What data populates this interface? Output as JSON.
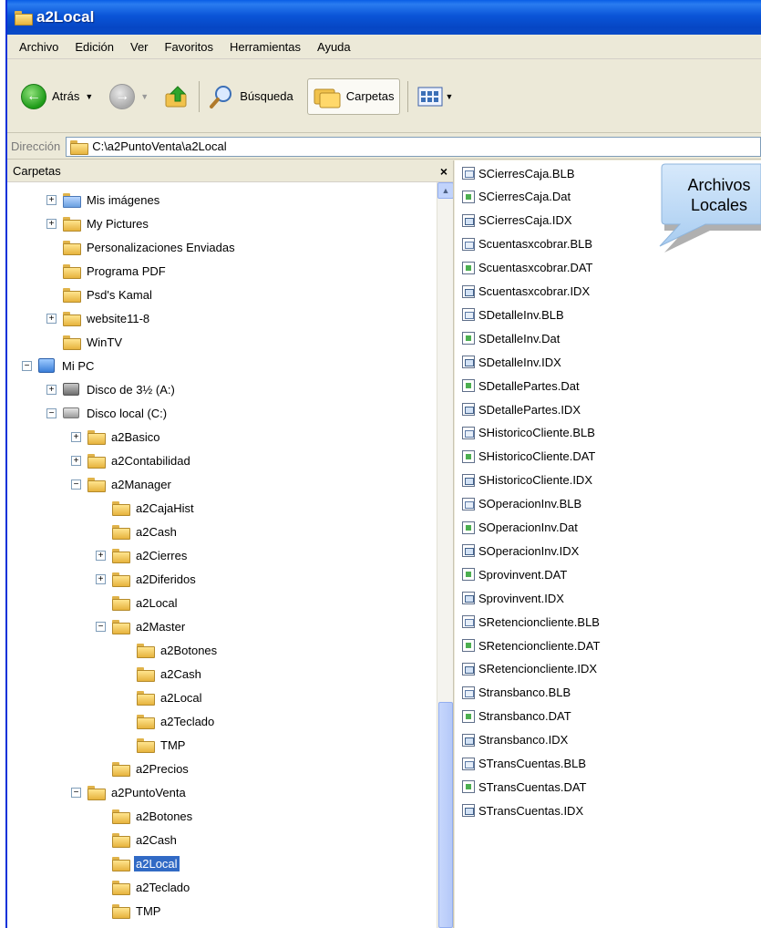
{
  "window": {
    "title": "a2Local"
  },
  "menu": [
    "Archivo",
    "Edición",
    "Ver",
    "Favoritos",
    "Herramientas",
    "Ayuda"
  ],
  "toolbar": {
    "back_label": "Atrás",
    "search_label": "Búsqueda",
    "folders_label": "Carpetas"
  },
  "address": {
    "label": "Dirección",
    "path": "C:\\a2PuntoVenta\\a2Local"
  },
  "tree": {
    "header": "Carpetas",
    "close": "×",
    "items": [
      {
        "label": "Mis imágenes",
        "depth": 1,
        "expander": "+",
        "icon": "image-folder"
      },
      {
        "label": "My Pictures",
        "depth": 1,
        "expander": "+",
        "icon": "folder"
      },
      {
        "label": "Personalizaciones Enviadas",
        "depth": 1,
        "expander": "",
        "icon": "folder"
      },
      {
        "label": "Programa PDF",
        "depth": 1,
        "expander": "",
        "icon": "folder"
      },
      {
        "label": "Psd's Kamal",
        "depth": 1,
        "expander": "",
        "icon": "folder"
      },
      {
        "label": "website11-8",
        "depth": 1,
        "expander": "+",
        "icon": "folder"
      },
      {
        "label": "WinTV",
        "depth": 1,
        "expander": "",
        "icon": "folder"
      },
      {
        "label": "Mi PC",
        "depth": 0,
        "expander": "−",
        "icon": "computer"
      },
      {
        "label": "Disco de 3½ (A:)",
        "depth": 1,
        "expander": "+",
        "icon": "floppy-drive"
      },
      {
        "label": "Disco local (C:)",
        "depth": 1,
        "expander": "−",
        "icon": "hard-drive"
      },
      {
        "label": "a2Basico",
        "depth": 2,
        "expander": "+",
        "icon": "folder"
      },
      {
        "label": "a2Contabilidad",
        "depth": 2,
        "expander": "+",
        "icon": "folder"
      },
      {
        "label": "a2Manager",
        "depth": 2,
        "expander": "−",
        "icon": "folder"
      },
      {
        "label": "a2CajaHist",
        "depth": 3,
        "expander": "",
        "icon": "folder"
      },
      {
        "label": "a2Cash",
        "depth": 3,
        "expander": "",
        "icon": "folder"
      },
      {
        "label": "a2Cierres",
        "depth": 3,
        "expander": "+",
        "icon": "folder"
      },
      {
        "label": "a2Diferidos",
        "depth": 3,
        "expander": "+",
        "icon": "folder"
      },
      {
        "label": "a2Local",
        "depth": 3,
        "expander": "",
        "icon": "folder"
      },
      {
        "label": "a2Master",
        "depth": 3,
        "expander": "−",
        "icon": "folder"
      },
      {
        "label": "a2Botones",
        "depth": 4,
        "expander": "",
        "icon": "folder"
      },
      {
        "label": "a2Cash",
        "depth": 4,
        "expander": "",
        "icon": "folder"
      },
      {
        "label": "a2Local",
        "depth": 4,
        "expander": "",
        "icon": "folder"
      },
      {
        "label": "a2Teclado",
        "depth": 4,
        "expander": "",
        "icon": "folder"
      },
      {
        "label": "TMP",
        "depth": 4,
        "expander": "",
        "icon": "folder"
      },
      {
        "label": "a2Precios",
        "depth": 3,
        "expander": "",
        "icon": "folder"
      },
      {
        "label": "a2PuntoVenta",
        "depth": 2,
        "expander": "−",
        "icon": "folder"
      },
      {
        "label": "a2Botones",
        "depth": 3,
        "expander": "",
        "icon": "folder"
      },
      {
        "label": "a2Cash",
        "depth": 3,
        "expander": "",
        "icon": "folder"
      },
      {
        "label": "a2Local",
        "depth": 3,
        "expander": "",
        "icon": "folder",
        "selected": true
      },
      {
        "label": "a2Teclado",
        "depth": 3,
        "expander": "",
        "icon": "folder"
      },
      {
        "label": "TMP",
        "depth": 3,
        "expander": "",
        "icon": "folder"
      }
    ]
  },
  "files": [
    {
      "name": "SCierresCaja.BLB",
      "type": "blb"
    },
    {
      "name": "SCierresCaja.Dat",
      "type": "dat"
    },
    {
      "name": "SCierresCaja.IDX",
      "type": "idx"
    },
    {
      "name": "Scuentasxcobrar.BLB",
      "type": "blb"
    },
    {
      "name": "Scuentasxcobrar.DAT",
      "type": "dat"
    },
    {
      "name": "Scuentasxcobrar.IDX",
      "type": "idx"
    },
    {
      "name": "SDetalleInv.BLB",
      "type": "blb"
    },
    {
      "name": "SDetalleInv.Dat",
      "type": "dat"
    },
    {
      "name": "SDetalleInv.IDX",
      "type": "idx"
    },
    {
      "name": "SDetallePartes.Dat",
      "type": "dat"
    },
    {
      "name": "SDetallePartes.IDX",
      "type": "idx"
    },
    {
      "name": "SHistoricoCliente.BLB",
      "type": "blb"
    },
    {
      "name": "SHistoricoCliente.DAT",
      "type": "dat"
    },
    {
      "name": "SHistoricoCliente.IDX",
      "type": "idx"
    },
    {
      "name": "SOperacionInv.BLB",
      "type": "blb"
    },
    {
      "name": "SOperacionInv.Dat",
      "type": "dat"
    },
    {
      "name": "SOperacionInv.IDX",
      "type": "idx"
    },
    {
      "name": "Sprovinvent.DAT",
      "type": "dat"
    },
    {
      "name": "Sprovinvent.IDX",
      "type": "idx"
    },
    {
      "name": "SRetencioncliente.BLB",
      "type": "blb"
    },
    {
      "name": "SRetencioncliente.DAT",
      "type": "dat"
    },
    {
      "name": "SRetencioncliente.IDX",
      "type": "idx"
    },
    {
      "name": "Stransbanco.BLB",
      "type": "blb"
    },
    {
      "name": "Stransbanco.DAT",
      "type": "dat"
    },
    {
      "name": "Stransbanco.IDX",
      "type": "idx"
    },
    {
      "name": "STransCuentas.BLB",
      "type": "blb"
    },
    {
      "name": "STransCuentas.DAT",
      "type": "dat"
    },
    {
      "name": "STransCuentas.IDX",
      "type": "idx"
    }
  ],
  "callout": {
    "line1": "Archivos",
    "line2": "Locales"
  }
}
